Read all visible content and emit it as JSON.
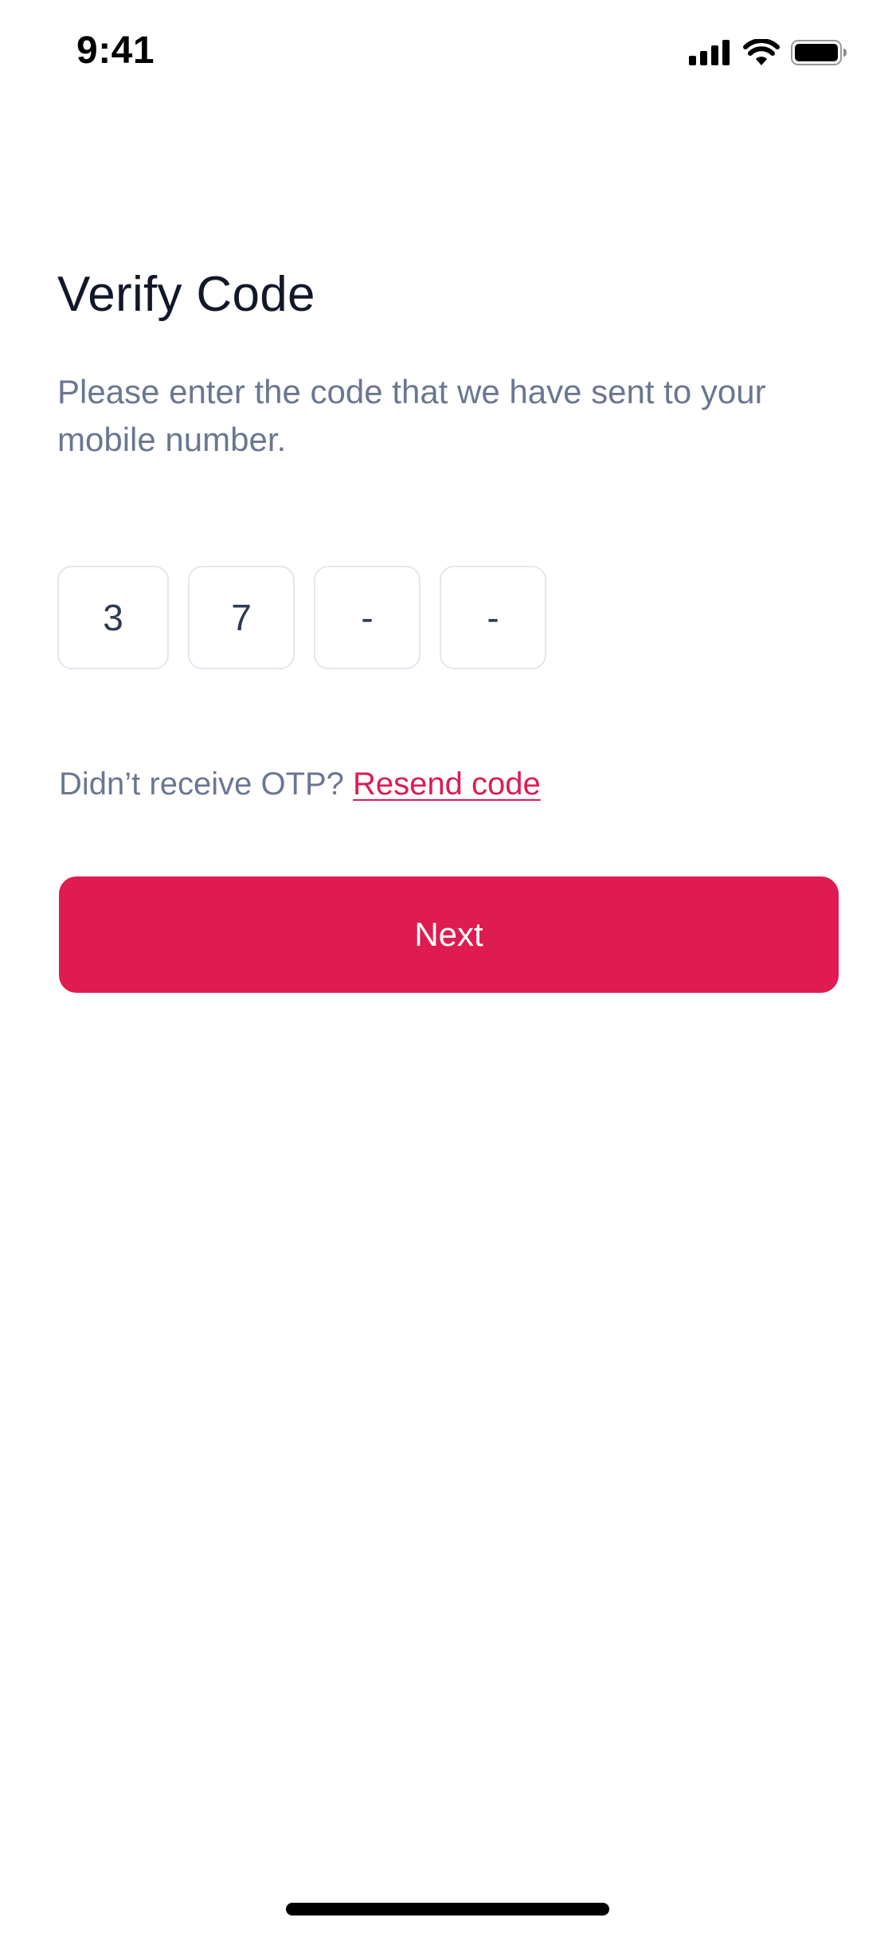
{
  "status_bar": {
    "time": "9:41",
    "icons": [
      "cellular-signal-icon",
      "wifi-icon",
      "battery-icon"
    ]
  },
  "screen": {
    "title": "Verify Code",
    "subtitle": "Please enter the code that we have sent to your mobile number.",
    "otp": {
      "digits": [
        "3",
        "7",
        "-",
        "-"
      ]
    },
    "resend": {
      "prompt": "Didn’t receive OTP?",
      "link_label": "Resend code"
    },
    "next_label": "Next"
  },
  "colors": {
    "accent": "#DE1C51",
    "title": "#111827",
    "muted_text": "#6B7791",
    "otp_border": "#E3E6EE"
  }
}
